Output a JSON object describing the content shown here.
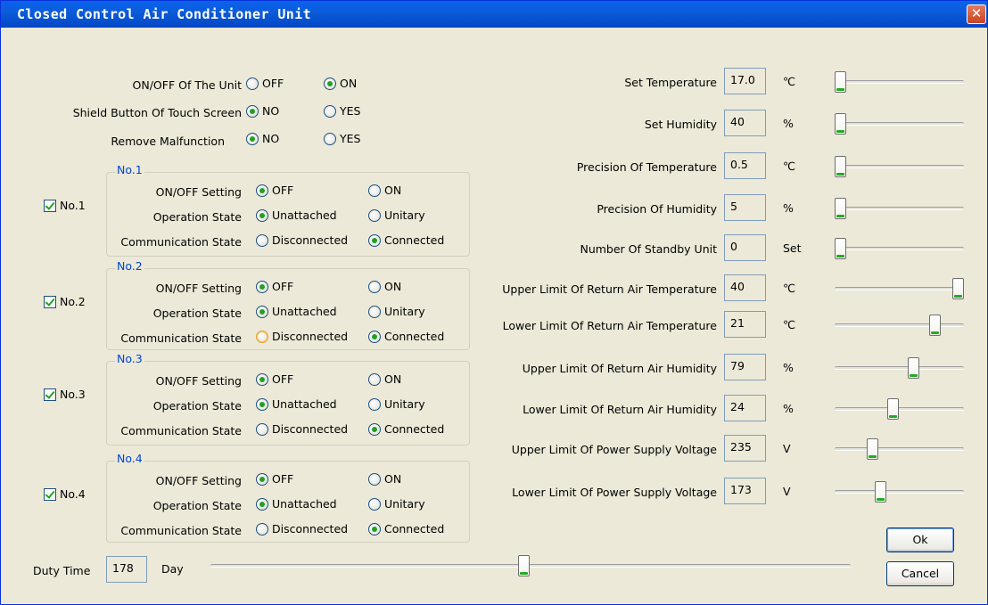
{
  "window": {
    "title": "Closed Control Air Conditioner Unit",
    "close_glyph": "✕"
  },
  "unit_settings": {
    "onoff": {
      "label": "ON/OFF Of The Unit",
      "options": [
        "OFF",
        "ON"
      ],
      "selected": "ON"
    },
    "shield": {
      "label": "Shield Button Of Touch Screen",
      "options": [
        "NO",
        "YES"
      ],
      "selected": "NO"
    },
    "malfunction": {
      "label": "Remove Malfunction",
      "options": [
        "NO",
        "YES"
      ],
      "selected": "NO"
    }
  },
  "row_labels": {
    "onoff": "ON/OFF Setting",
    "operation": "Operation State",
    "communication": "Communication State"
  },
  "units": [
    {
      "checkbox_label": "No.1",
      "group_title": "No.1",
      "checked": true,
      "onoff": {
        "options": [
          "OFF",
          "ON"
        ],
        "selected": "OFF"
      },
      "operation": {
        "options": [
          "Unattached",
          "Unitary"
        ],
        "selected": "Unattached"
      },
      "communication": {
        "options": [
          "Disconnected",
          "Connected"
        ],
        "selected": "Connected"
      }
    },
    {
      "checkbox_label": "No.2",
      "group_title": "No.2",
      "checked": true,
      "onoff": {
        "options": [
          "OFF",
          "ON"
        ],
        "selected": "OFF"
      },
      "operation": {
        "options": [
          "Unattached",
          "Unitary"
        ],
        "selected": "Unattached"
      },
      "communication": {
        "options": [
          "Disconnected",
          "Connected"
        ],
        "selected": "Connected"
      }
    },
    {
      "checkbox_label": "No.3",
      "group_title": "No.3",
      "checked": true,
      "onoff": {
        "options": [
          "OFF",
          "ON"
        ],
        "selected": "OFF"
      },
      "operation": {
        "options": [
          "Unattached",
          "Unitary"
        ],
        "selected": "Unattached"
      },
      "communication": {
        "options": [
          "Disconnected",
          "Connected"
        ],
        "selected": "Connected"
      }
    },
    {
      "checkbox_label": "No.4",
      "group_title": "No.4",
      "checked": true,
      "onoff": {
        "options": [
          "OFF",
          "ON"
        ],
        "selected": "OFF"
      },
      "operation": {
        "options": [
          "Unattached",
          "Unitary"
        ],
        "selected": "Unattached"
      },
      "communication": {
        "options": [
          "Disconnected",
          "Connected"
        ],
        "selected": "Connected"
      }
    }
  ],
  "duty_time": {
    "label": "Duty Time",
    "value": "178",
    "unit": "Day",
    "slider_fraction": 0.49
  },
  "params": [
    {
      "label": "Set Temperature",
      "value": "17.0",
      "unit": "℃",
      "slider_fraction": 0.0
    },
    {
      "label": "Set Humidity",
      "value": "40",
      "unit": "%",
      "slider_fraction": 0.0
    },
    {
      "label": "Precision Of Temperature",
      "value": "0.5",
      "unit": "℃",
      "slider_fraction": 0.0
    },
    {
      "label": "Precision Of Humidity",
      "value": "5",
      "unit": "%",
      "slider_fraction": 0.0
    },
    {
      "label": "Number Of Standby Unit",
      "value": "0",
      "unit": "Set",
      "slider_fraction": 0.0
    },
    {
      "label": "Upper Limit Of Return Air Temperature",
      "value": "40",
      "unit": "℃",
      "slider_fraction": 1.0
    },
    {
      "label": "Lower Limit Of Return Air Temperature",
      "value": "21",
      "unit": "℃",
      "slider_fraction": 0.8
    },
    {
      "label": "Upper Limit Of Return Air Humidity",
      "value": "79",
      "unit": "%",
      "slider_fraction": 0.62
    },
    {
      "label": "Lower Limit Of Return Air Humidity",
      "value": "24",
      "unit": "%",
      "slider_fraction": 0.45
    },
    {
      "label": "Upper Limit Of Power Supply Voltage",
      "value": "235",
      "unit": "V",
      "slider_fraction": 0.27
    },
    {
      "label": "Lower Limit Of Power Supply Voltage",
      "value": "173",
      "unit": "V",
      "slider_fraction": 0.34
    }
  ],
  "buttons": {
    "ok": "Ok",
    "cancel": "Cancel"
  },
  "colors": {
    "group_title": "#0046d5",
    "check_green": "#21a121",
    "title_bar": "#0b5bd8",
    "close_button": "#c74524"
  }
}
